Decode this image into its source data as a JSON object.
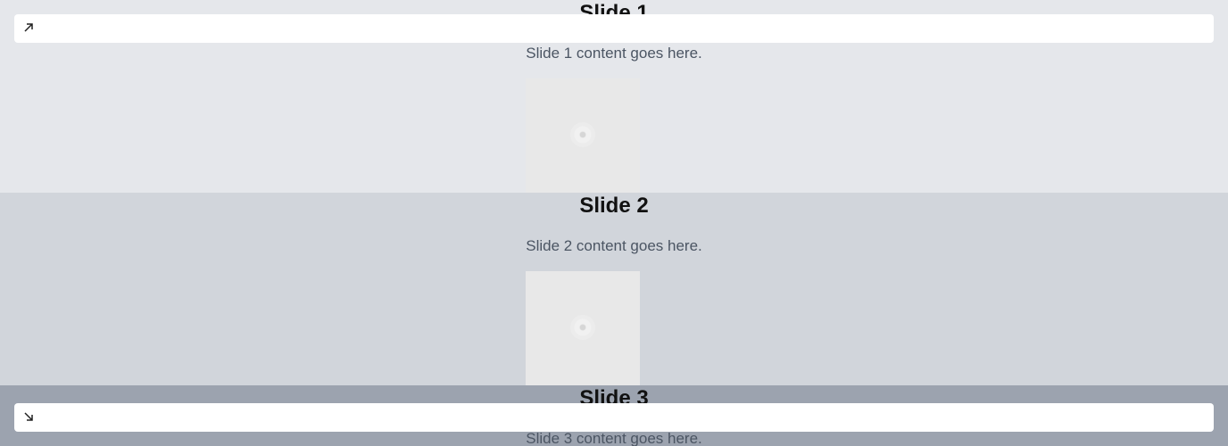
{
  "slides": [
    {
      "title": "Slide 1",
      "content": "Slide 1 content goes here."
    },
    {
      "title": "Slide 2",
      "content": "Slide 2 content goes here."
    },
    {
      "title": "Slide 3",
      "content": "Slide 3 content goes here."
    }
  ],
  "navigation": {
    "prev_icon": "arrow-up-right-icon",
    "next_icon": "arrow-down-right-icon"
  },
  "colors": {
    "slide_1_bg": "#e5e7eb",
    "slide_2_bg": "#d1d5db",
    "slide_3_bg": "#9ca3af",
    "nav_bg": "#ffffff",
    "text_muted": "#4b5563",
    "title": "#111111"
  }
}
